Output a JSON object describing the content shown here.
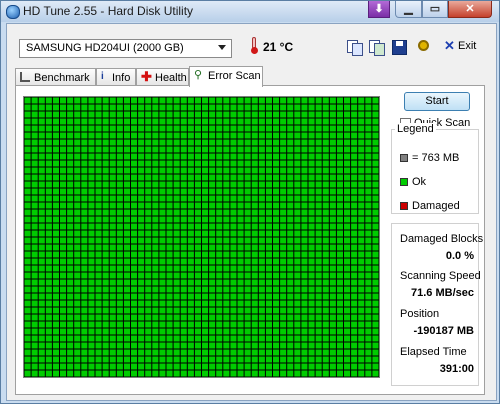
{
  "window": {
    "title": "HD Tune 2.55 - Hard Disk Utility"
  },
  "toolbar": {
    "drive": "SAMSUNG HD204UI (2000 GB)",
    "temperature": "21 °C",
    "exit_label": "Exit",
    "icons": [
      "copy-info-icon",
      "copy-screenshot-icon",
      "save-icon",
      "options-icon",
      "exit-icon"
    ]
  },
  "tabs": [
    {
      "label": "Benchmark",
      "active": false,
      "icon": "benchmark-icon"
    },
    {
      "label": "Info",
      "active": false,
      "icon": "info-icon"
    },
    {
      "label": "Health",
      "active": false,
      "icon": "health-icon"
    },
    {
      "label": "Error Scan",
      "active": true,
      "icon": "search-icon"
    }
  ],
  "scan": {
    "start_label": "Start",
    "quick_scan_label": "Quick Scan",
    "quick_scan_checked": false,
    "grid": {
      "columns": 50,
      "rows": 40,
      "all_ok": true
    }
  },
  "legend": {
    "title": "Legend",
    "items": [
      {
        "label": "= 763 MB",
        "color": "#808080"
      },
      {
        "label": "Ok",
        "color": "#00cc00"
      },
      {
        "label": "Damaged",
        "color": "#cc0000"
      }
    ]
  },
  "stats": {
    "damaged_label": "Damaged Blocks",
    "damaged_value": "0.0 %",
    "speed_label": "Scanning Speed",
    "speed_value": "71.6 MB/sec",
    "position_label": "Position",
    "position_value": "-190187 MB",
    "elapsed_label": "Elapsed Time",
    "elapsed_value": "391:00"
  },
  "colors": {
    "ok": "#00cc00",
    "grid_line": "#1a1a1a"
  }
}
